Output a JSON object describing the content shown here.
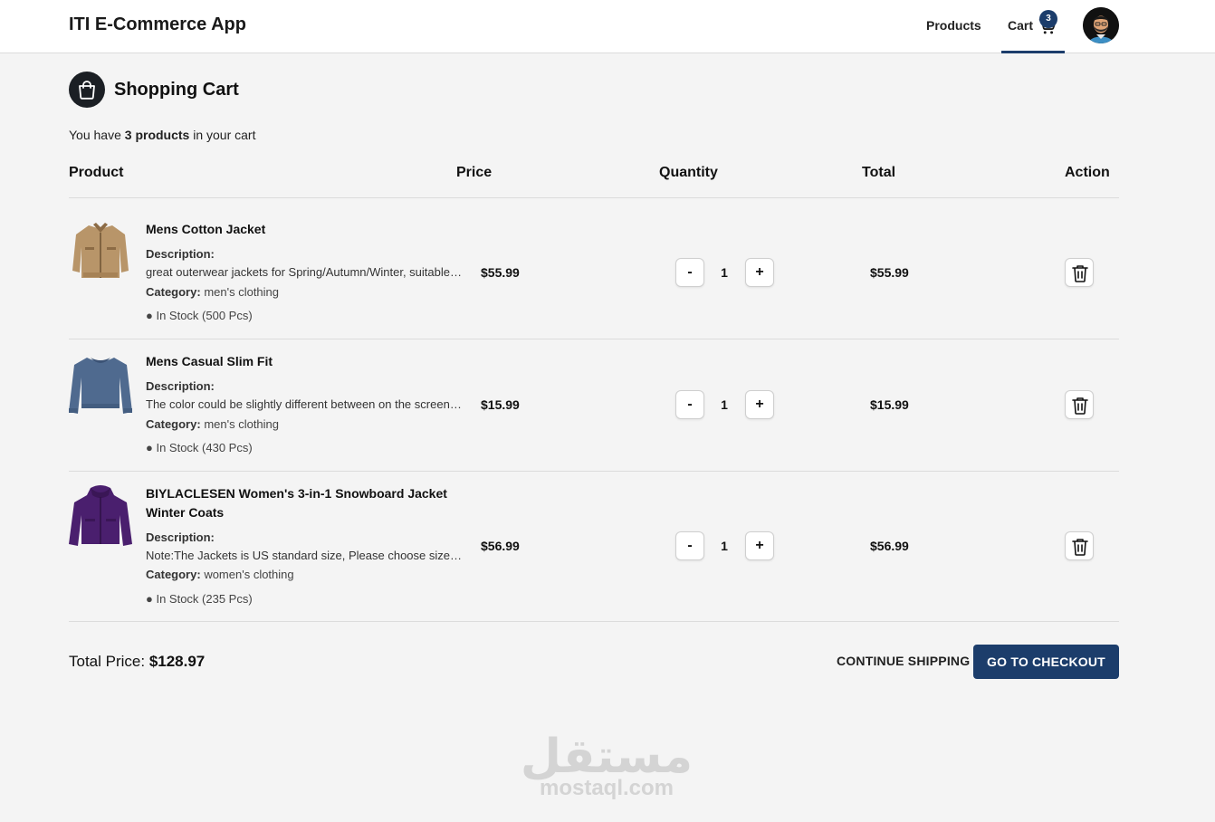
{
  "header": {
    "title": "ITI E-Commerce App",
    "nav_products": "Products",
    "nav_cart": "Cart",
    "cart_count": "3"
  },
  "page": {
    "title": "Shopping Cart",
    "summary_prefix": "You have ",
    "summary_count": "3 products",
    "summary_suffix": " in your cart"
  },
  "table": {
    "headers": [
      "Product",
      "Price",
      "Quantity",
      "Total",
      "Action"
    ]
  },
  "items": [
    {
      "name": "Mens Cotton Jacket",
      "description_label": "Description:",
      "description": "great outerwear jackets for Spring/Autumn/Winter, suitable for many occasions, such as working, hiking, camping, mountain/rock climbing, cycling, traveling or other outdoors.",
      "category_label": "Category:",
      "category": "men's clothing",
      "stock": "● In Stock (500 Pcs)",
      "price": "$55.99",
      "minus": "-",
      "quantity": "1",
      "plus": "+",
      "total": "$55.99"
    },
    {
      "name": "Mens Casual Slim Fit",
      "description_label": "Description:",
      "description": "The color could be slightly different between on the screen and in practice. / Please note that body builds vary by person.",
      "category_label": "Category:",
      "category": "men's clothing",
      "stock": "● In Stock (430 Pcs)",
      "price": "$15.99",
      "minus": "-",
      "quantity": "1",
      "plus": "+",
      "total": "$15.99"
    },
    {
      "name": "BIYLACLESEN Women's 3-in-1 Snowboard Jacket Winter Coats",
      "description_label": "Description:",
      "description": "Note:The Jackets is US standard size, Please choose size as your usual wear Material: 100% Polyester",
      "category_label": "Category:",
      "category": "women's clothing",
      "stock": "● In Stock (235 Pcs)",
      "price": "$56.99",
      "minus": "-",
      "quantity": "1",
      "plus": "+",
      "total": "$56.99"
    }
  ],
  "footer": {
    "total_label": "Total Price: ",
    "total_value": "$128.97",
    "continue_label": "CONTINUE SHIPPING",
    "checkout_label": "GO TO CHECKOUT"
  },
  "watermark": {
    "arabic": "مستقل",
    "latin": "mostaql.com"
  },
  "icons": {
    "cart": "cart-icon",
    "bag": "shopping-bag-icon",
    "trash": "trash-icon",
    "avatar": "user-avatar"
  },
  "colors": {
    "accent": "#1c3d6b",
    "background": "#f4f4f4",
    "header": "#ffffff"
  }
}
